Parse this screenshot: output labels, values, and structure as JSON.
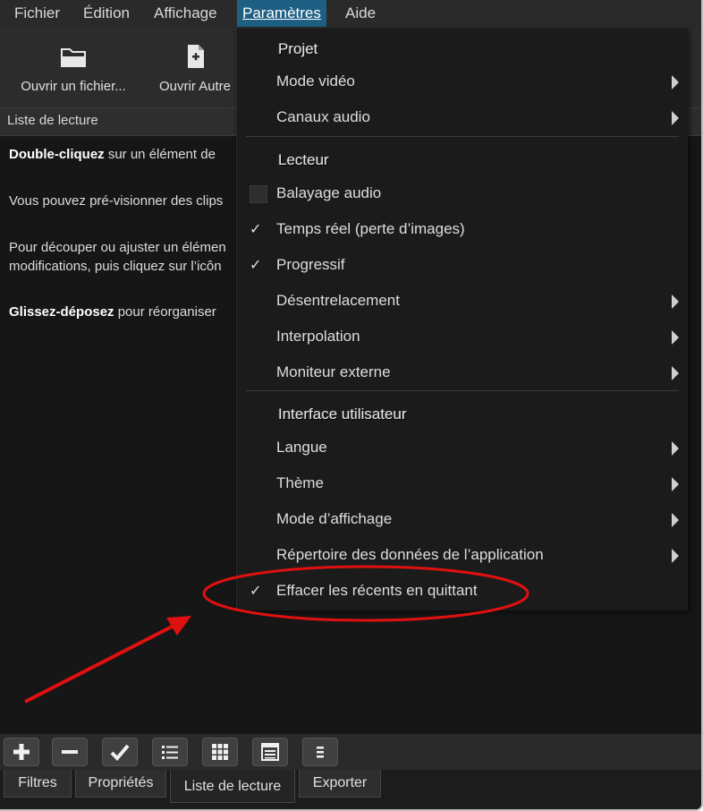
{
  "menubar": {
    "items": [
      "Fichier",
      "Édition",
      "Affichage",
      "Paramètres",
      "Aide"
    ]
  },
  "toolbar": {
    "open_file": "Ouvrir un fichier...",
    "open_other": "Ouvrir Autre"
  },
  "playlist": {
    "header": "Liste de lecture",
    "help1_bold": "Double-cliquez",
    "help1_rest": " sur un élément de",
    "help2": "Vous pouvez pré-visionner des clips",
    "help3a": "Pour découper ou ajuster un élémen",
    "help3b": "modifications, puis cliquez sur l’icôn",
    "help4_bold": "Glissez-déposez",
    "help4_rest": " pour réorganiser"
  },
  "dropdown": {
    "section_projet": "Projet",
    "mode_video": "Mode vidéo",
    "canaux_audio": "Canaux audio",
    "section_lecteur": "Lecteur",
    "balayage_audio": "Balayage audio",
    "temps_reel": "Temps réel (perte d’images)",
    "progressif": "Progressif",
    "desentrelacement": "Désentrelacement",
    "interpolation": "Interpolation",
    "moniteur_externe": "Moniteur externe",
    "section_interface": "Interface utilisateur",
    "langue": "Langue",
    "theme": "Thème",
    "mode_affichage": "Mode d’affichage",
    "repertoire": "Répertoire des données de l’application",
    "effacer_recents": "Effacer les récents en quittant",
    "check_glyph": "✓"
  },
  "tabs": [
    "Filtres",
    "Propriétés",
    "Liste de lecture",
    "Exporter"
  ],
  "colors": {
    "accent": "#1e5f84",
    "annotation": "#e01010"
  }
}
